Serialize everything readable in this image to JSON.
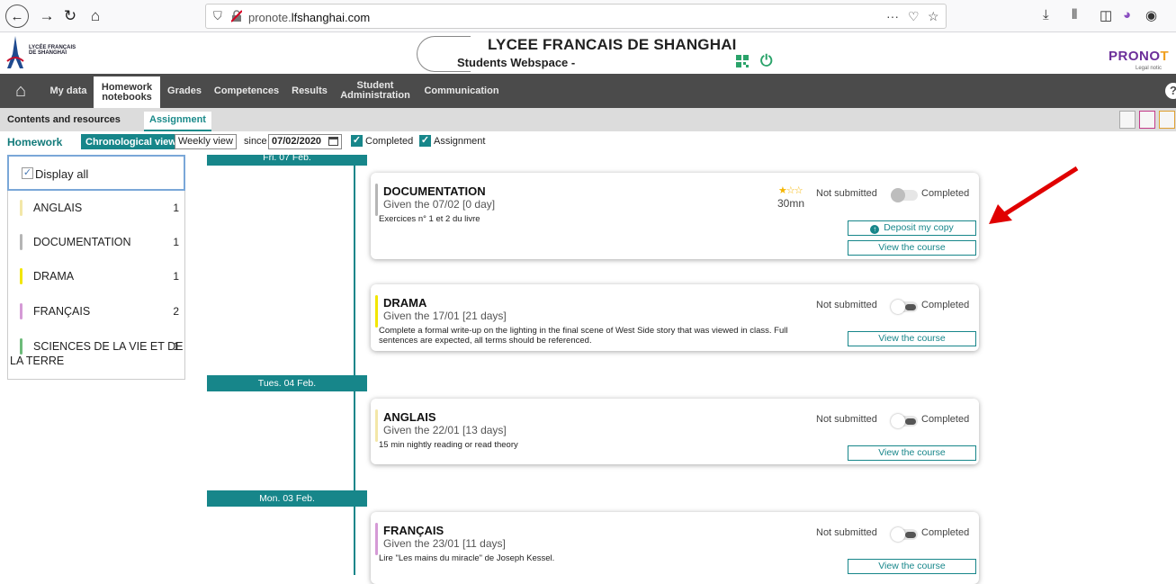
{
  "browser": {
    "url_prefix": "pronote.",
    "url_domain": "lfshanghai.com",
    "url_menu": "···"
  },
  "header": {
    "logo_line1": "LYCÉE FRANÇAIS",
    "logo_line2": "DE SHANGHAI",
    "school_name": "LYCEE FRANCAIS DE SHANGHAI",
    "space_name": "Students Webspace -",
    "pronote_logo_a": "PRONO",
    "pronote_logo_b": "T",
    "legal": "Legal notic"
  },
  "nav": {
    "my_data": "My data",
    "homework_line1": "Homework",
    "homework_line2": "notebooks",
    "grades": "Grades",
    "competences": "Competences",
    "results": "Results",
    "student_admin_line1": "Student",
    "student_admin_line2": "Administration",
    "communication": "Communication",
    "help": "?"
  },
  "subnav": {
    "contents": "Contents and resources",
    "assignment": "Assignment"
  },
  "filters": {
    "homework": "Homework",
    "chronological": "Chronological view",
    "weekly": "Weekly view",
    "since": "since",
    "date": "07/02/2020",
    "completed": "Completed",
    "assignment": "Assignment"
  },
  "subjects": {
    "display_all": "Display all",
    "items": [
      {
        "name": "ANGLAIS",
        "count": "1",
        "color": "#f3e7a8"
      },
      {
        "name": "DOCUMENTATION",
        "count": "1",
        "color": "#b5b5b5"
      },
      {
        "name": "DRAMA",
        "count": "1",
        "color": "#f2e600"
      },
      {
        "name": "FRANÇAIS",
        "count": "2",
        "color": "#d59ad6"
      },
      {
        "name": "SCIENCES DE LA VIE ET DE",
        "name2": "LA TERRE",
        "count": "1",
        "color": "#6dbb7a"
      }
    ]
  },
  "timeline": {
    "date1": "Fri. 07 Feb.",
    "date2": "Tues. 04 Feb.",
    "date3": "Mon. 03 Feb."
  },
  "cards": [
    {
      "subject": "DOCUMENTATION",
      "given": "Given the 07/02 [0 day]",
      "desc": "Exercices n° 1 et 2 du livre",
      "stars": "★☆☆",
      "duration": "30mn",
      "status_not": "Not submitted",
      "status_done": "Completed",
      "deposit": "Deposit my copy",
      "view": "View the course"
    },
    {
      "subject": "DRAMA",
      "given": "Given the 17/01 [21 days]",
      "desc1": "Complete a formal write-up on the lighting in the final scene of West Side story that was viewed in class. Full",
      "desc2": "sentences are expected, all terms should be referenced.",
      "status_not": "Not submitted",
      "status_done": "Completed",
      "view": "View the course"
    },
    {
      "subject": "ANGLAIS",
      "given": "Given the 22/01 [13 days]",
      "desc": "15 min nightly reading or read theory",
      "status_not": "Not submitted",
      "status_done": "Completed",
      "view": "View the course"
    },
    {
      "subject": "FRANÇAIS",
      "given": "Given the 23/01 [11 days]",
      "desc": "Lire \"Les mains du miracle\" de Joseph Kessel.",
      "status_not": "Not submitted",
      "status_done": "Completed",
      "view": "View the course"
    }
  ]
}
